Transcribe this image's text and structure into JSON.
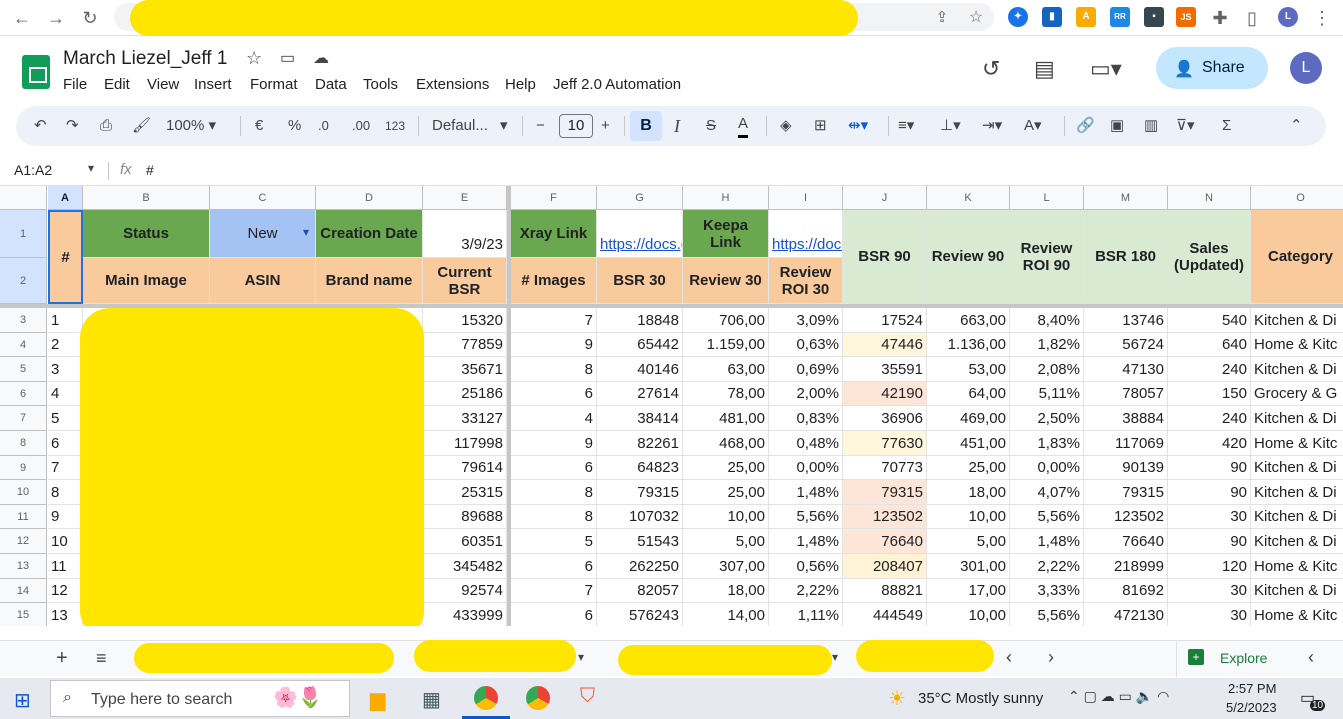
{
  "browser": {
    "back": "←",
    "forward": "→",
    "reload": "↻"
  },
  "doc": {
    "title": "March Liezel_Jeff 1"
  },
  "menus": [
    "File",
    "Edit",
    "View",
    "Insert",
    "Format",
    "Data",
    "Tools",
    "Extensions",
    "Help",
    "Jeff 2.0 Automation"
  ],
  "share_label": "Share",
  "avatar_letter": "L",
  "toolbar": {
    "zoom": "100%",
    "currency": "€",
    "percent": "%",
    "dec_decrease": ".0",
    "dec_increase": ".00",
    "format_123": "123",
    "font": "Defaul...",
    "font_size": "10",
    "minus": "−",
    "plus": "+",
    "bold": "B",
    "italic": "I",
    "strike": "S",
    "text_color": "A"
  },
  "formula": {
    "name_box": "A1:A2",
    "fx": "fx",
    "content": "#"
  },
  "columns": [
    "A",
    "B",
    "C",
    "D",
    "E",
    "F",
    "G",
    "H",
    "I",
    "J",
    "K",
    "L",
    "M",
    "N",
    "O"
  ],
  "header_row1": {
    "A": "#",
    "B": "Status",
    "C": "New",
    "D": "Creation Date",
    "E": "3/9/23",
    "F": "Xray Link",
    "G": "https://docs.g",
    "H": "Keepa Link",
    "I": "https://docs",
    "J": "BSR 90",
    "K": "Review 90",
    "L": "Review ROI 90",
    "M": "BSR 180",
    "N": "Sales (Updated)",
    "O": "Category"
  },
  "header_row2": {
    "B": "Main Image",
    "C": "ASIN",
    "D": "Brand name",
    "E": "Current BSR",
    "F": "# Images",
    "G": "BSR 30",
    "H": "Review 30",
    "I": "Review ROI 30"
  },
  "row_numbers": [
    "1",
    "2",
    "3",
    "4",
    "5",
    "6",
    "7",
    "8",
    "9",
    "10",
    "11",
    "12",
    "13",
    "14",
    "15"
  ],
  "rows": [
    {
      "A": "1",
      "E": "15320",
      "F": "7",
      "G": "18848",
      "H": "706,00",
      "I": "3,09%",
      "J": "17524",
      "K": "663,00",
      "L": "8,40%",
      "M": "13746",
      "N": "540",
      "O": "Kitchen & Di"
    },
    {
      "A": "2",
      "E": "77859",
      "F": "9",
      "G": "65442",
      "H": "1.159,00",
      "I": "0,63%",
      "J": "47446",
      "K": "1.136,00",
      "L": "1,82%",
      "M": "56724",
      "N": "640",
      "O": "Home & Kitc"
    },
    {
      "A": "3",
      "E": "35671",
      "F": "8",
      "G": "40146",
      "H": "63,00",
      "I": "0,69%",
      "J": "35591",
      "K": "53,00",
      "L": "2,08%",
      "M": "47130",
      "N": "240",
      "O": "Kitchen & Di"
    },
    {
      "A": "4",
      "E": "25186",
      "F": "6",
      "G": "27614",
      "H": "78,00",
      "I": "2,00%",
      "J": "42190",
      "K": "64,00",
      "L": "5,11%",
      "M": "78057",
      "N": "150",
      "O": "Grocery & G"
    },
    {
      "A": "5",
      "E": "33127",
      "F": "4",
      "G": "38414",
      "H": "481,00",
      "I": "0,83%",
      "J": "36906",
      "K": "469,00",
      "L": "2,50%",
      "M": "38884",
      "N": "240",
      "O": "Kitchen & Di"
    },
    {
      "A": "6",
      "E": "117998",
      "F": "9",
      "G": "82261",
      "H": "468,00",
      "I": "0,48%",
      "J": "77630",
      "K": "451,00",
      "L": "1,83%",
      "M": "117069",
      "N": "420",
      "O": "Home & Kitc"
    },
    {
      "A": "7",
      "E": "79614",
      "F": "6",
      "G": "64823",
      "H": "25,00",
      "I": "0,00%",
      "J": "70773",
      "K": "25,00",
      "L": "0,00%",
      "M": "90139",
      "N": "90",
      "O": "Kitchen & Di"
    },
    {
      "A": "8",
      "E": "25315",
      "F": "8",
      "G": "79315",
      "H": "25,00",
      "I": "1,48%",
      "J": "79315",
      "K": "18,00",
      "L": "4,07%",
      "M": "79315",
      "N": "90",
      "O": "Kitchen & Di"
    },
    {
      "A": "9",
      "E": "89688",
      "F": "8",
      "G": "107032",
      "H": "10,00",
      "I": "5,56%",
      "J": "123502",
      "K": "10,00",
      "L": "5,56%",
      "M": "123502",
      "N": "30",
      "O": "Kitchen & Di"
    },
    {
      "A": "10",
      "E": "60351",
      "F": "5",
      "G": "51543",
      "H": "5,00",
      "I": "1,48%",
      "J": "76640",
      "K": "5,00",
      "L": "1,48%",
      "M": "76640",
      "N": "90",
      "O": "Kitchen & Di"
    },
    {
      "A": "11",
      "E": "345482",
      "F": "6",
      "G": "262250",
      "H": "307,00",
      "I": "0,56%",
      "J": "208407",
      "K": "301,00",
      "L": "2,22%",
      "M": "218999",
      "N": "120",
      "O": "Home & Kitc"
    },
    {
      "A": "12",
      "E": "92574",
      "F": "7",
      "G": "82057",
      "H": "18,00",
      "I": "2,22%",
      "J": "88821",
      "K": "17,00",
      "L": "3,33%",
      "M": "81692",
      "N": "30",
      "O": "Kitchen & Di"
    },
    {
      "A": "13",
      "E": "433999",
      "F": "6",
      "G": "576243",
      "H": "14,00",
      "I": "1,11%",
      "J": "444549",
      "K": "10,00",
      "L": "5,56%",
      "M": "472130",
      "N": "30",
      "O": "Home & Kitc"
    }
  ],
  "partial_text": {
    "r2": ")",
    "r9": "L",
    "r10": "E",
    "r11": "L",
    "r12": "B0",
    "r13": "B("
  },
  "j_colors": [
    "#ffffff",
    "#fff6dc",
    "#ffffff",
    "#fde6d8",
    "#ffffff",
    "#fff6dc",
    "#ffffff",
    "#fde6d8",
    "#fde6d8",
    "#fde6d8",
    "#fff3d6",
    "#ffffff",
    "#ffffff"
  ],
  "bottom": {
    "plus": "+",
    "explore": "Explore"
  },
  "taskbar": {
    "search_placeholder": "Type here to search",
    "weather": "35°C  Mostly sunny",
    "time": "2:57 PM",
    "date": "5/2/2023",
    "notif_count": "10"
  },
  "colors": {
    "green_header": "#6aa84f",
    "blue_header": "#a4c2f4",
    "orange_header": "#f9cb9c",
    "lightgreen_header": "#d9ead3",
    "orange_O": "#f9cb9c",
    "accent": "#0b57d0"
  }
}
